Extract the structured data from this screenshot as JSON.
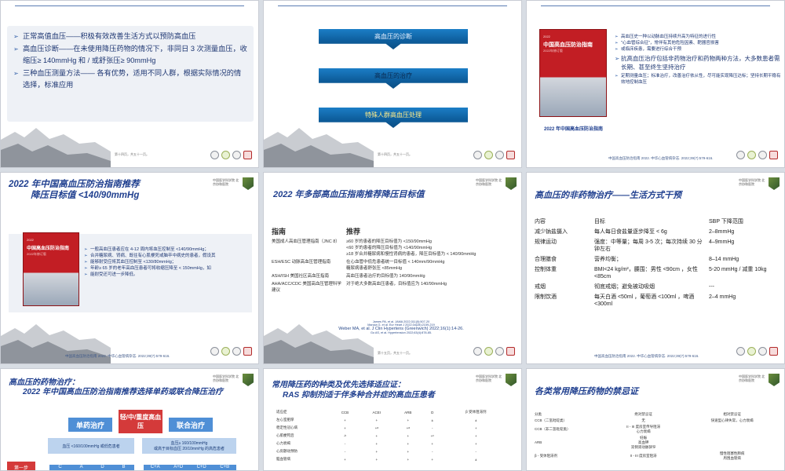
{
  "colors": {
    "title": "#1f3f8f",
    "accent": "#2f5ea8",
    "banner": "#0e5f9e",
    "book_red": "#c21e24"
  },
  "slide1": {
    "bullets": [
      "正常高值血压——积极有效改善生活方式以预防高血压",
      "高血压诊断——在未使用降压药物的情况下，非同日 3 次测量血压，收缩压≥ 140mmHg 和 / 或舒张压≥ 90mmHg",
      "三种血压测量方法—— 各有优势，适用不同人群，根据实际情况的情选择，标准应用"
    ],
    "page": "第十四页，共五十一页。"
  },
  "slide2": {
    "banners": [
      "高血压的诊断",
      "高血压的治疗",
      "特殊人群高血压处理"
    ],
    "page": "第十四页，共五十一页。"
  },
  "slide3": {
    "book": {
      "year": "2022",
      "title": "中国高血压防治指南",
      "subtitle": "2022年修订版"
    },
    "caption": "2022 年中国高血压防治指南",
    "items": [
      "高血压史一种以动脉血压持续升高为特征的进行性",
      "\"心血管综合征\"，常伴有其他危险因素、靶器官损害",
      "或临床疾患，需要进行综合干预",
      "抗高血压治疗包括非药物治疗和药物两种方法，大多数患者需长期、甚至终生坚持治疗",
      "定期测量血压；标准治疗，改善治疗依从性，尽可能实现降压达标；坚持长期平稳有效地控制血压"
    ],
    "footer": "中国高血压防治指南 2022. 中华心血管病杂志. 2022;39(7):579-616."
  },
  "slide4": {
    "title1": "2022 年中国高血压防治指南推荐",
    "title2": "降压目标值 <140/90mmHg",
    "book": {
      "year": "2022",
      "title": "中国高血压防治指南",
      "subtitle": "2022年修订版"
    },
    "items": [
      "一般高血压患者应在 4-12 周内将血压控制至 <140/90mmHg；",
      "合并糖尿病、肾病、既往有心肌梗死或脑卒中病史的患者，假设其",
      "能够耐受应将其血压控制至 <130/80mmHg；",
      "年龄≥ 65 岁的老年高血压患者可将收缩压降至 < 150mmHg，如",
      "能耐受还可进一步降低。"
    ],
    "footer": "中国高血压防治指南 2022. 中华心血管病杂志. 2022;39(7):579-616."
  },
  "slide5": {
    "title": "2022 年多部高血压指南推荐降压目标值",
    "headers": [
      "指南",
      "推荐"
    ],
    "rows": [
      {
        "guide": "美国成人高血压管理指南（JNC 8）",
        "rec": [
          "≥60 岁的患者的降压目标值为 <150/90mmHg",
          "<60 岁的患者的降压目标值为 <140/90mmHg",
          "≥18 岁合并糖尿病和慢性肾病的患者，降压目标值为 < 140/90mmHg"
        ]
      },
      {
        "guide": "ESH/ESC 动脉高血压管理指南",
        "rec": [
          "在心血管中低危患者统一目标值 < 140mm/90mmHg",
          "糖尿病患者舒张压 <85mmHg"
        ]
      },
      {
        "guide": "ASH/ISH 美国社区高血压指南",
        "rec": [
          "高血压患者治疗的目标值为 140/90mmHg"
        ]
      },
      {
        "guide": "AHA/ACC/CDC 美国高血压管理科学建议",
        "rec": [
          "对于绝大多数高血压患者，目标值应为 140/90mmHg"
        ]
      }
    ],
    "refs": [
      "James PA, et al. JAMA 2022;311(5):507-20",
      "Mancia G, et al. Eur Heart J 2022;34(28):2159-219",
      "Weber MA, et al. J Clin Hypertens (Greenwich) 2022;16(1):14-26.",
      "Go AS, et al. Hypertension 2022;63(4):878-85."
    ],
    "page": "第十五页，共五十一页。"
  },
  "slide6": {
    "title": "高血压的非药物治疗——生活方式干预",
    "headers": [
      "内容",
      "目标",
      "SBP 下降范围"
    ],
    "rows": [
      [
        "减少钠盐摄入",
        "每人每日食盐量逐步降至 < 6g",
        "2–8mmHg"
      ],
      [
        "规律运动",
        "强度：中等量；每周 3-5 次；每次持续 30 分钟左右",
        "4–9mmHg"
      ],
      [
        "合理膳食",
        "营养均衡；",
        "8–14 mmHg"
      ],
      [
        "控制体重",
        "BMI<24 kg/m²，腰围：男性 <90cm ，女性 <85cm",
        "5-20 mmHg / 减重 10kg"
      ],
      [
        "戒烟",
        "彻底戒烟；避免被动吸烟",
        "---"
      ],
      [
        "限制饮酒",
        "每天白酒 <50ml ，葡萄酒 <100ml ，啤酒 <300ml",
        "2–4 mmHg"
      ]
    ],
    "footer": "中国高血压防治指南 2022. 中华心血管病杂志. 2022;39(7):579-616."
  },
  "slide7": {
    "title1": "高血压的药物治疗：",
    "title2": "2022 年中国高血压防治指南推荐选择单药或联合降压治疗",
    "mono": "单药治疗",
    "combo": "联合治疗",
    "center": "轻/中/重度高血压",
    "mono_cond": "血压 <160/100mmHg 或低危患者",
    "combo_cond": "血压≥ 160/100mmHg\n或高于目标血压 20/10mmHg 的高危患者",
    "step": "第一步",
    "mono_opts": [
      "C",
      "A",
      "D",
      "B"
    ],
    "combo_opts": [
      "C+A",
      "A+D",
      "C+D",
      "C+B"
    ]
  },
  "slide8": {
    "title1": "常用降压药的种类及优先选择适应证：",
    "title2": "RAS 抑制剂适于伴多种合并症的高血压患者",
    "headers": [
      "适应症",
      "CCB",
      "ACEI",
      "ARB",
      "D",
      "β 受体阻滞剂"
    ],
    "rows": [
      [
        "左心室肥厚",
        "+",
        "+",
        "+",
        "±",
        "±"
      ],
      [
        "稳定性冠心病",
        "+",
        "+ᵃ",
        "+ᵃ",
        "-",
        "+"
      ],
      [
        "心肌梗死后",
        "-ᵇ",
        "+",
        "+",
        "+ᶜ",
        "+"
      ],
      [
        "心力衰竭",
        "-",
        "+",
        "+",
        "+",
        "+"
      ],
      [
        "心房颤动预防",
        "-",
        "+",
        "+",
        "-",
        "-"
      ],
      [
        "脑血管病",
        "+",
        "+",
        "+",
        "+",
        "±"
      ]
    ]
  },
  "slide9": {
    "title": "各类常用降压药物的禁忌证",
    "headers": [
      "分类",
      "绝对禁忌证",
      "相对禁忌证"
    ],
    "rows": [
      [
        "CCB（二氢吡啶类）",
        "无",
        "快速型心律失常，心力衰竭"
      ],
      [
        "CCB（非二氢吡啶类）",
        "II - III 度房室传导阻滞\n心力衰竭",
        ""
      ],
      [
        "ARB",
        "妊娠\n高血钾\n双侧肾动脉狭窄",
        ""
      ],
      [
        "β - 受体阻滞剂",
        "II - III 度房室阻滞",
        "慢性阻塞性肺病\n周围血管病"
      ]
    ]
  }
}
